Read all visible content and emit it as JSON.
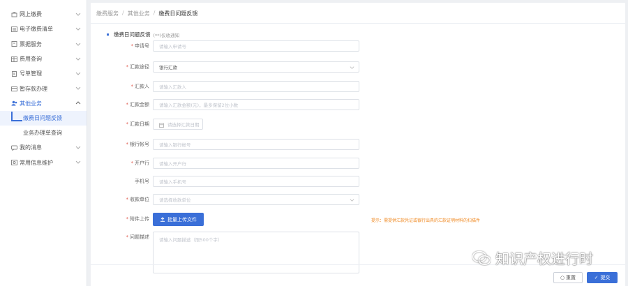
{
  "sidebar": {
    "items": [
      {
        "label": "网上缴费",
        "icon": "store-icon"
      },
      {
        "label": "电子缴费清单",
        "icon": "list-icon"
      },
      {
        "label": "票据服务",
        "icon": "receipt-icon"
      },
      {
        "label": "费用查询",
        "icon": "table-icon"
      },
      {
        "label": "号单管理",
        "icon": "document-icon"
      },
      {
        "label": "暂存款办理",
        "icon": "wallet-icon"
      },
      {
        "label": "其他业务",
        "icon": "user-group-icon"
      }
    ],
    "sub_items": [
      {
        "label": "缴费日问题反馈"
      },
      {
        "label": "业务办理单查询"
      }
    ],
    "more_items": [
      {
        "label": "我的消息",
        "icon": "message-icon"
      },
      {
        "label": "常用信息维护",
        "icon": "settings-icon"
      }
    ]
  },
  "breadcrumb": {
    "items": [
      "缴费服务",
      "其他业务"
    ],
    "current": "缴费日问题反馈"
  },
  "form": {
    "title": "缴费日问题反馈",
    "subtitle": "(**)仅收通知",
    "fields": [
      {
        "label": "申请号",
        "required": true,
        "placeholder": "请输入申请号"
      },
      {
        "label": "汇款途径",
        "required": true,
        "value": "银行汇款"
      },
      {
        "label": "汇款人",
        "required": true,
        "placeholder": "请输入汇款人"
      },
      {
        "label": "汇款金额",
        "required": true,
        "placeholder": "请输入汇款金额(元)，最多保留2位小数"
      },
      {
        "label": "汇款日期",
        "required": true,
        "placeholder": "请选择汇款日期"
      },
      {
        "label": "银行帐号",
        "required": true,
        "placeholder": "请输入银行帐号"
      },
      {
        "label": "开户行",
        "required": true,
        "placeholder": "请输入开户行"
      },
      {
        "label": "手机号",
        "required": false,
        "placeholder": "请输入手机号"
      },
      {
        "label": "收款单位",
        "required": true,
        "placeholder": "请选择收款单位"
      }
    ],
    "attachment": {
      "label": "附件上传",
      "button": "批量上传文件",
      "hint": "提示：需提供汇款凭证或银行出具的汇款证明材料的扫描件"
    },
    "description": {
      "label": "问题描述",
      "placeholder": "请输入问题描述（限500个字）"
    }
  },
  "actions": {
    "reset": "重置",
    "submit": "提交"
  },
  "watermark": {
    "text": "知识产权进行时"
  },
  "colors": {
    "accent": "#3a6fd8",
    "hint": "#f08a24",
    "required": "#e05a4e"
  }
}
